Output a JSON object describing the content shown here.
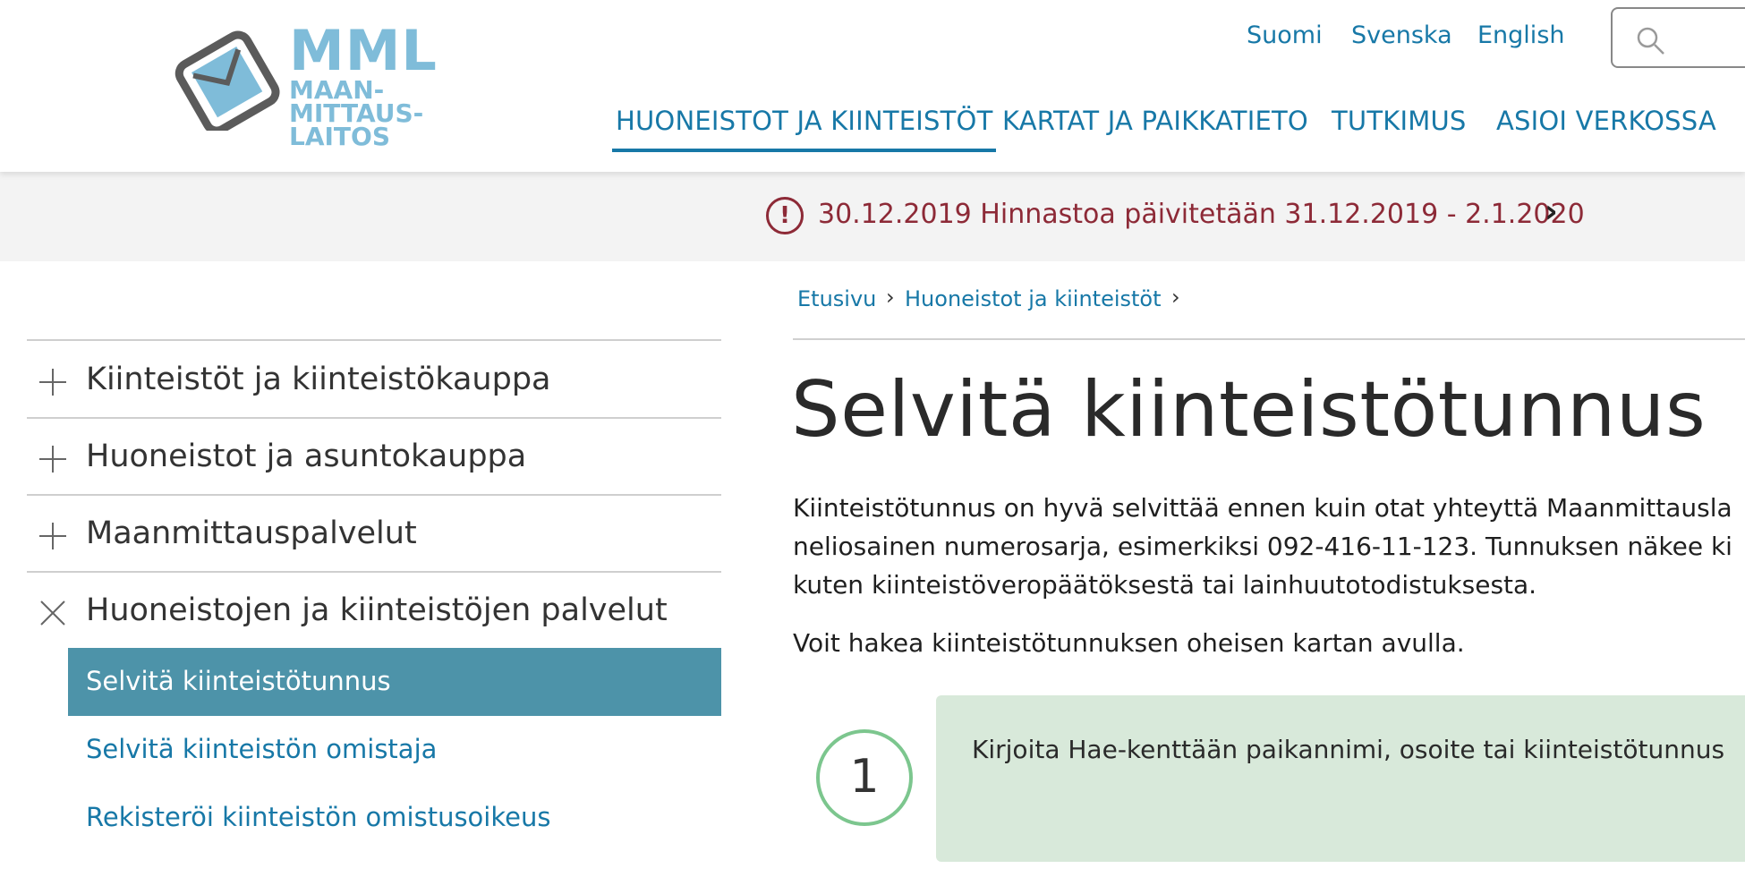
{
  "logo": {
    "abbr": "MML",
    "line1": "MAAN-",
    "line2": "MITTAUS-",
    "line3": "LAITOS"
  },
  "languages": [
    "Suomi",
    "Svenska",
    "English"
  ],
  "search": {
    "icon": "search-icon"
  },
  "main_nav": [
    {
      "label": "HUONEISTOT JA KIINTEISTÖT",
      "active": true
    },
    {
      "label": "KARTAT JA PAIKKATIETO",
      "active": false
    },
    {
      "label": "TUTKIMUS",
      "active": false
    },
    {
      "label": "ASIOI VERKOSSA",
      "active": false
    }
  ],
  "notice": {
    "icon": "alert-icon",
    "text": "30.12.2019 Hinnastoa päivitetään 31.12.2019 - 2.1.2020",
    "chevron": "›"
  },
  "breadcrumb": [
    {
      "label": "Etusivu",
      "sep": "›"
    },
    {
      "label": "Huoneistot ja kiinteistöt",
      "sep": "›"
    }
  ],
  "sidebar": {
    "items": [
      {
        "label": "Kiinteistöt ja kiinteistökauppa",
        "icon": "plus-icon"
      },
      {
        "label": "Huoneistot ja asuntokauppa",
        "icon": "plus-icon"
      },
      {
        "label": "Maanmittauspalvelut",
        "icon": "plus-icon"
      },
      {
        "label": "Huoneistojen ja kiinteistöjen palvelut",
        "icon": "close-icon"
      }
    ],
    "subitems": [
      {
        "label": "Selvitä kiinteistötunnus",
        "active": true
      },
      {
        "label": "Selvitä kiinteistön omistaja",
        "active": false
      },
      {
        "label": "Rekisteröi kiinteistön omistusoikeus",
        "active": false
      }
    ]
  },
  "main": {
    "title": "Selvitä kiinteistötunnus",
    "intro_lines": [
      "Kiinteistötunnus on hyvä selvittää ennen kuin otat yhteyttä Maanmittausla",
      "neliosainen numerosarja, esimerkiksi 092-416-11-123. Tunnuksen näkee ki",
      "kuten kiinteistöveropäätöksestä tai lainhuutotodistuksesta."
    ],
    "intro2": "Voit hakea kiinteistötunnuksen oheisen kartan avulla.",
    "step": {
      "number": "1",
      "text": "Kirjoita Hae-kenttään paikannimi, osoite tai kiinteistötunnus"
    }
  },
  "colors": {
    "link": "#1778a7",
    "notice": "#8d2a37",
    "sidebar_active": "#4d93a9",
    "step_bg": "#d8e9da",
    "step_ring": "#7cc68e",
    "logo": "#7fbcd9"
  }
}
